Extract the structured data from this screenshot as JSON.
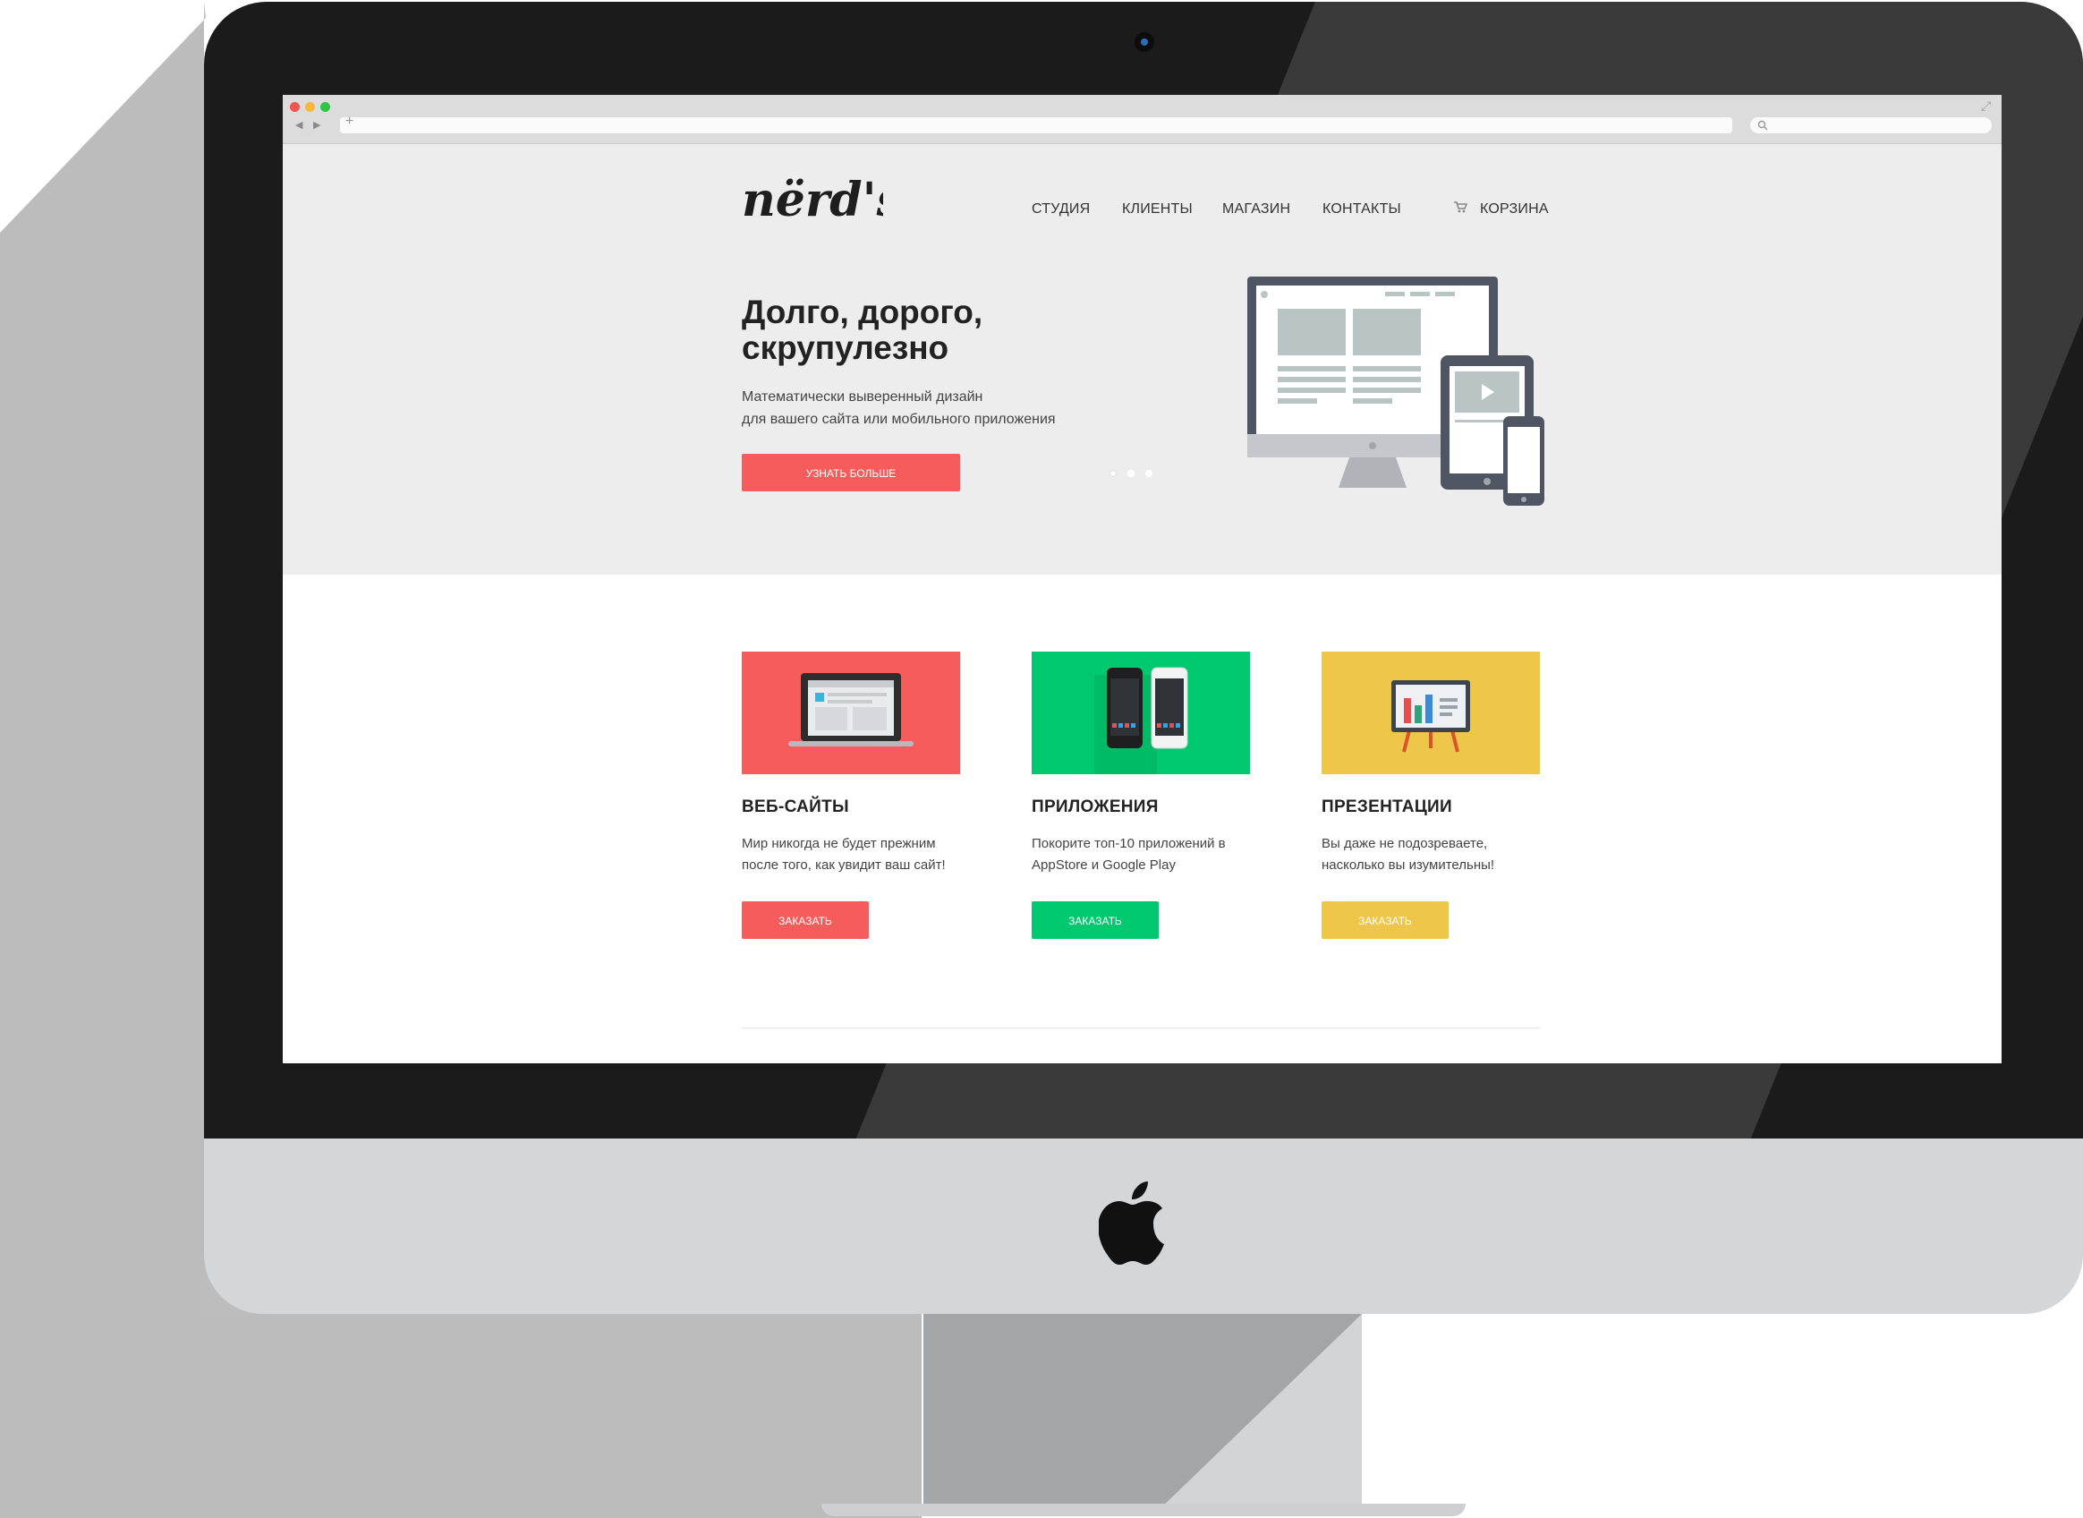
{
  "header": {
    "logo_text": "nërd's",
    "nav": [
      {
        "label": "СТУДИЯ"
      },
      {
        "label": "КЛИЕНТЫ"
      },
      {
        "label": "МАГАЗИН"
      },
      {
        "label": "КОНТАКТЫ"
      }
    ],
    "cart_label": "КОРЗИНА"
  },
  "hero": {
    "title_line1": "Долго, дорого,",
    "title_line2": "скрупулезно",
    "subtitle_line1": "Математически выверенный дизайн",
    "subtitle_line2": "для вашего сайта или мобильного приложения",
    "button_label": "УЗНАТЬ БОЛЬШЕ",
    "slider_dots": 3,
    "active_slide": 1
  },
  "services": [
    {
      "title": "ВЕБ-САЙТЫ",
      "desc_line1": "Мир никогда не будет прежним",
      "desc_line2": "после того, как увидит ваш сайт!",
      "button_label": "ЗАКАЗАТЬ",
      "color": "#f75c5d",
      "icon": "laptop-icon"
    },
    {
      "title": "ПРИЛОЖЕНИЯ",
      "desc_line1": "Покорите топ-10 приложений в",
      "desc_line2": "AppStore и Google Play",
      "button_label": "ЗАКАЗАТЬ",
      "color": "#00c86f",
      "icon": "smartphones-icon"
    },
    {
      "title": "ПРЕЗЕНТАЦИИ",
      "desc_line1": "Вы даже не подозреваете,",
      "desc_line2": "насколько вы изумительны!",
      "button_label": "ЗАКАЗАТЬ",
      "color": "#eec64a",
      "icon": "presentation-board-icon"
    }
  ],
  "colors": {
    "accent_red": "#f75c5d",
    "accent_green": "#00c86f",
    "accent_yellow": "#eec64a",
    "hero_bg": "#ededed",
    "device_dark": "#4f5563"
  }
}
